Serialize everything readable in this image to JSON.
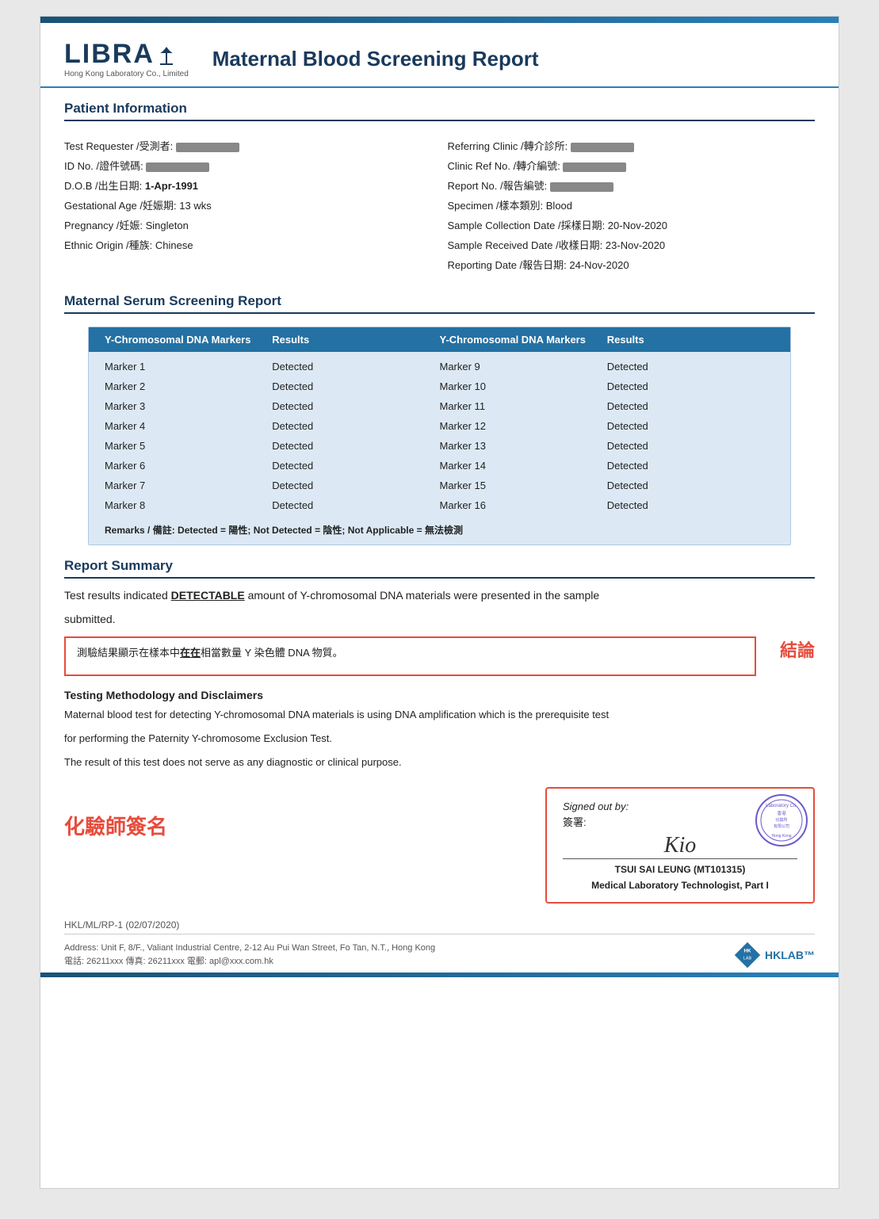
{
  "header": {
    "logo_text": "LIBRA",
    "logo_subtitle": "Hong Kong Laboratory Co., Limited",
    "report_title": "Maternal Blood Screening Report"
  },
  "patient_info": {
    "section_label": "Patient Information",
    "fields_left": [
      {
        "label": "Test Requester /受測者:",
        "value": "REDACTED"
      },
      {
        "label": "ID No. /證件號碼:",
        "value": "REDACTED"
      },
      {
        "label": "D.O.B /出生日期:",
        "value": "1-Apr-1991"
      },
      {
        "label": "Gestational Age /妊娠期:",
        "value": "13 wks"
      },
      {
        "label": "Pregnancy /妊娠:",
        "value": "Singleton"
      },
      {
        "label": "Ethnic Origin /種族:",
        "value": "Chinese"
      }
    ],
    "fields_right": [
      {
        "label": "Referring Clinic /轉介診所:",
        "value": "REDACTED"
      },
      {
        "label": "Clinic Ref No. /轉介編號:",
        "value": "REDACTED"
      },
      {
        "label": "Report No. /報告編號:",
        "value": "REDACTED"
      },
      {
        "label": "Specimen /樣本類別:",
        "value": "Blood"
      },
      {
        "label": "Sample Collection Date /採樣日期:",
        "value": "20-Nov-2020"
      },
      {
        "label": "Sample Received Date /收樣日期:",
        "value": "23-Nov-2020"
      },
      {
        "label": "Reporting Date /報告日期:",
        "value": "24-Nov-2020"
      }
    ]
  },
  "serum_section": {
    "section_label": "Maternal Serum Screening Report",
    "col1_header": "Y-Chromosomal DNA Markers",
    "col2_header": "Results",
    "col3_header": "Y-Chromosomal DNA Markers",
    "col4_header": "Results",
    "markers_left": [
      {
        "marker": "Marker 1",
        "result": "Detected"
      },
      {
        "marker": "Marker 2",
        "result": "Detected"
      },
      {
        "marker": "Marker 3",
        "result": "Detected"
      },
      {
        "marker": "Marker 4",
        "result": "Detected"
      },
      {
        "marker": "Marker 5",
        "result": "Detected"
      },
      {
        "marker": "Marker 6",
        "result": "Detected"
      },
      {
        "marker": "Marker 7",
        "result": "Detected"
      },
      {
        "marker": "Marker 8",
        "result": "Detected"
      }
    ],
    "markers_right": [
      {
        "marker": "Marker 9",
        "result": "Detected"
      },
      {
        "marker": "Marker 10",
        "result": "Detected"
      },
      {
        "marker": "Marker 11",
        "result": "Detected"
      },
      {
        "marker": "Marker 12",
        "result": "Detected"
      },
      {
        "marker": "Marker 13",
        "result": "Detected"
      },
      {
        "marker": "Marker 14",
        "result": "Detected"
      },
      {
        "marker": "Marker 15",
        "result": "Detected"
      },
      {
        "marker": "Marker 16",
        "result": "Detected"
      }
    ],
    "remarks": "Remarks / 備註: Detected = 陽性; Not Detected = 陰性; Not Applicable = 無法檢測"
  },
  "report_summary": {
    "section_label": "Report Summary",
    "summary_line1": "Test results indicated ",
    "summary_bold": "DETECTABLE",
    "summary_line2": " amount of Y-chromosomal DNA materials were presented in the sample",
    "summary_line3": "submitted.",
    "box_line1": "測驗結果顯示在樣本中",
    "box_bold": "在在",
    "box_line2": "相當數量 Y 染色體 DNA 物質。",
    "conclusion_label": "結論"
  },
  "methodology": {
    "header": "Testing Methodology and Disclaimers",
    "text1": "Maternal blood test for detecting Y-chromosomal DNA materials is using DNA amplification which is the prerequisite test",
    "text2": "for performing the Paternity Y-chromosome Exclusion Test.",
    "text3": "The result of this test does not serve as any diagnostic or clinical purpose."
  },
  "signature": {
    "chemist_label": "化驗師簽名",
    "signed_out_by": "Signed out by:",
    "signed_chinese": "簽署:",
    "sign_cursive": "Kio",
    "signer_name": "TSUI SAI LEUNG (MT101315)",
    "signer_title": "Medical Laboratory Technologist, Part I"
  },
  "footer": {
    "ref": "HKL/ML/RP-1 (02/07/2020)",
    "address": "Address: Unit F, 8/F., Valiant Industrial Centre, 2-12 Au Pui Wan Street, Fo Tan, N.T., Hong Kong",
    "contact": "電話: 26211xxx   傳真: 26211xxx   電郵: apl@xxx.com.hk"
  }
}
